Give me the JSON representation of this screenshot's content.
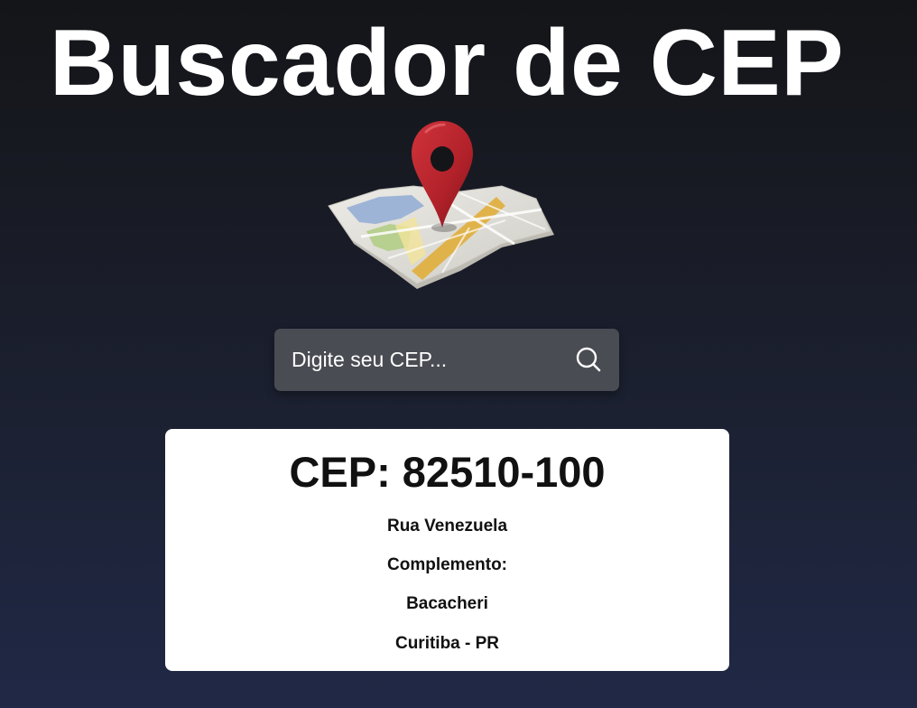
{
  "page": {
    "title": "Buscador de CEP"
  },
  "illustration": {
    "icon": "map-with-location-pin",
    "colors": {
      "pin": "#b5222a",
      "water": "#9eb4d6",
      "park": "#b7cf8f",
      "road": "#e0b24a",
      "map_paper": "#dcdad4"
    }
  },
  "search": {
    "placeholder": "Digite seu CEP...",
    "value": "",
    "icon": "search-icon"
  },
  "result": {
    "cep": "CEP: 82510-100",
    "street": "Rua Venezuela",
    "complement": "Complemento:",
    "neighborhood": "Bacacheri",
    "city_state": "Curitiba - PR"
  },
  "colors": {
    "background_top": "#141518",
    "background_bottom": "#202846",
    "search_box": "#4a4c53",
    "card": "#ffffff",
    "title": "#ffffff"
  }
}
